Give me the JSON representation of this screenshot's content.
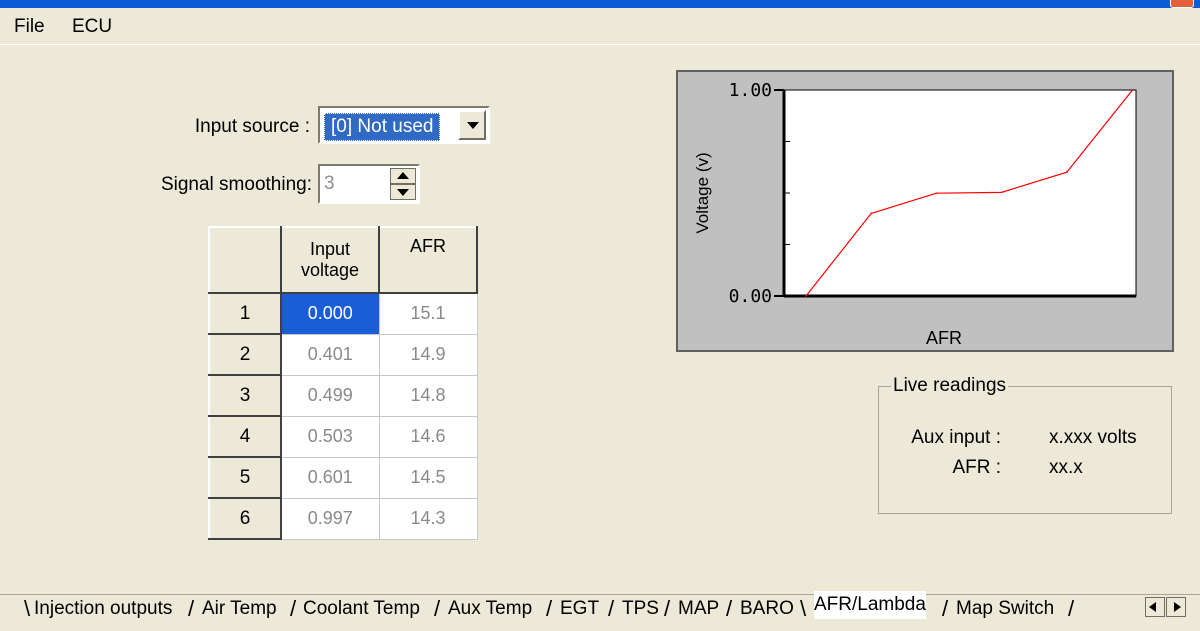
{
  "menu": {
    "items": [
      "File",
      "ECU"
    ]
  },
  "form": {
    "input_source_label": "Input source :",
    "input_source_value": "[0]  Not used",
    "signal_smoothing_label": "Signal smoothing:",
    "signal_smoothing_value": "3"
  },
  "table": {
    "headers": {
      "input_voltage_line1": "Input",
      "input_voltage_line2": "voltage",
      "afr": "AFR"
    },
    "rows": [
      {
        "index": "1",
        "voltage": "0.000",
        "afr": "15.1"
      },
      {
        "index": "2",
        "voltage": "0.401",
        "afr": "14.9"
      },
      {
        "index": "3",
        "voltage": "0.499",
        "afr": "14.8"
      },
      {
        "index": "4",
        "voltage": "0.503",
        "afr": "14.6"
      },
      {
        "index": "5",
        "voltage": "0.601",
        "afr": "14.5"
      },
      {
        "index": "6",
        "voltage": "0.997",
        "afr": "14.3"
      }
    ],
    "selected_row_index": 0
  },
  "chart_data": {
    "type": "line",
    "title": "",
    "xlabel": "AFR",
    "ylabel": "Voltage (v)",
    "ylim": [
      0,
      1
    ],
    "y_tick_labels": [
      "1.00",
      "0.00"
    ],
    "x": [
      "15.1",
      "14.9",
      "14.8",
      "14.6",
      "14.5",
      "14.3"
    ],
    "series": [
      {
        "values": [
          0.0,
          0.401,
          0.499,
          0.503,
          0.601,
          0.997
        ],
        "color": "#ff0000"
      }
    ],
    "grid": false,
    "background": "#ffffff"
  },
  "live": {
    "title": "Live readings",
    "aux_label": "Aux input :",
    "aux_value": "x.xxx  volts",
    "afr_label": "AFR :",
    "afr_value": "xx.x"
  },
  "tabs": [
    {
      "label": "Injection outputs",
      "active": false
    },
    {
      "label": "Air Temp",
      "active": false
    },
    {
      "label": "Coolant Temp",
      "active": false
    },
    {
      "label": "Aux Temp",
      "active": false
    },
    {
      "label": "EGT",
      "active": false
    },
    {
      "label": "TPS",
      "active": false
    },
    {
      "label": "MAP",
      "active": false
    },
    {
      "label": "BARO",
      "active": false
    },
    {
      "label": "AFR/Lambda",
      "active": true
    },
    {
      "label": "Map Switch",
      "active": false
    }
  ],
  "colors": {
    "selection": "#1a5ed7",
    "series": "#ff0000",
    "window_bg": "#ece9d8"
  }
}
